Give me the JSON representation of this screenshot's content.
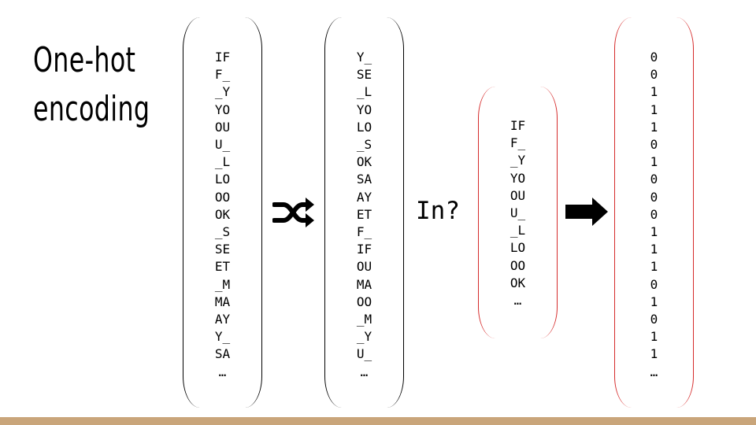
{
  "title": {
    "line1": "One-hot",
    "line2": "encoding"
  },
  "columns": {
    "bigrams": [
      "IF",
      "F_",
      "_Y",
      "YO",
      "OU",
      "U_",
      "_L",
      "LO",
      "OO",
      "OK",
      "_S",
      "SE",
      "ET",
      "_M",
      "MA",
      "AY",
      "Y_",
      "SA",
      "…"
    ],
    "shuffled": [
      "Y_",
      "SE",
      "_L",
      "YO",
      "LO",
      "_S",
      "OK",
      "SA",
      "AY",
      "ET",
      "F_",
      "IF",
      "OU",
      "MA",
      "OO",
      "_M",
      "_Y",
      "U_",
      "…"
    ],
    "query": [
      "IF",
      "F_",
      "_Y",
      "YO",
      "OU",
      "U_",
      "_L",
      "LO",
      "OO",
      "OK",
      "…"
    ],
    "encoding": [
      "0",
      "0",
      "1",
      "1",
      "1",
      "0",
      "1",
      "0",
      "0",
      "0",
      "1",
      "1",
      "1",
      "0",
      "1",
      "0",
      "1",
      "1",
      "…"
    ]
  },
  "in_label": "In?",
  "icons": {
    "shuffle": "shuffle-icon",
    "arrow": "right-arrow-icon"
  },
  "colors": {
    "red_bracket": "#d52a2a",
    "footer_bar": "#c9a57a"
  }
}
